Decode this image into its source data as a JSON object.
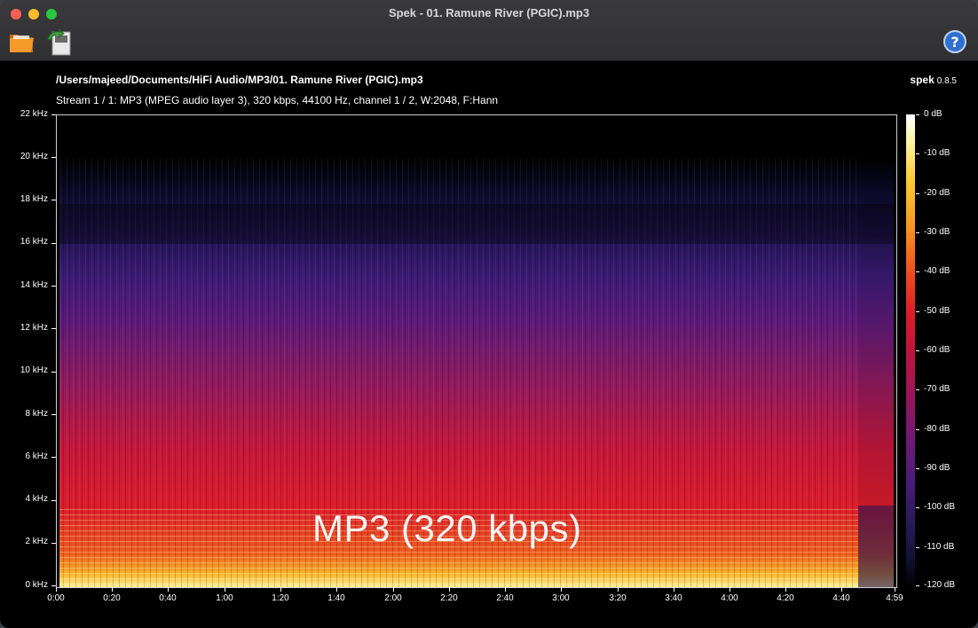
{
  "window": {
    "title": "Spek - 01. Ramune River (PGIC).mp3"
  },
  "toolbar": {
    "open_icon": "folder-icon",
    "save_icon": "save-icon",
    "help_icon": "help-icon"
  },
  "header": {
    "file_path": "/Users/majeed/Documents/HiFi Audio/MP3/01. Ramune River (PGIC).mp3",
    "stream_info": "Stream 1 / 1: MP3 (MPEG audio layer 3), 320 kbps, 44100 Hz, channel 1 / 2, W:2048, F:Hann",
    "app_name": "spek",
    "app_version": "0.8.5"
  },
  "spectrogram": {
    "freq_labels": [
      "22 kHz",
      "20 kHz",
      "18 kHz",
      "16 kHz",
      "14 kHz",
      "12 kHz",
      "10 kHz",
      "8 kHz",
      "6 kHz",
      "4 kHz",
      "2 kHz",
      "0 kHz"
    ],
    "time_labels": [
      "0:00",
      "0:20",
      "0:40",
      "1:00",
      "1:20",
      "1:40",
      "2:00",
      "2:20",
      "2:40",
      "3:00",
      "3:20",
      "3:40",
      "4:00",
      "4:20",
      "4:40",
      "4:59"
    ],
    "db_labels": [
      "0 dB",
      "-10 dB",
      "-20 dB",
      "-30 dB",
      "-40 dB",
      "-50 dB",
      "-60 dB",
      "-70 dB",
      "-80 dB",
      "-90 dB",
      "-100 dB",
      "-110 dB",
      "-120 dB"
    ],
    "overlay_text": "MP3 (320 kbps)",
    "colors": {
      "hot": "#fff4a0",
      "mid": "#dc1d2a",
      "cool": "#6b1a78",
      "cold": "#111238"
    }
  }
}
